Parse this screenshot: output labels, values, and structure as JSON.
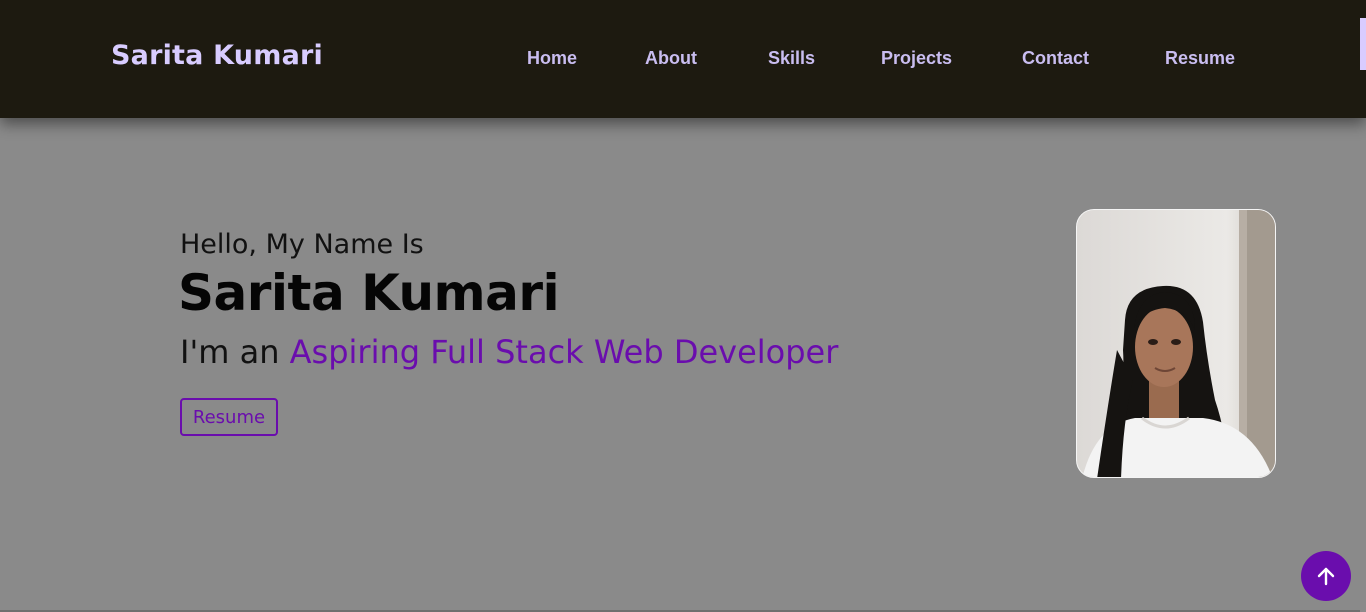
{
  "navbar": {
    "brand": "Sarita Kumari",
    "links": [
      "Home",
      "About",
      "Skills",
      "Projects",
      "Contact",
      "Resume"
    ]
  },
  "hero": {
    "greeting": "Hello, My Name Is",
    "name": "Sarita Kumari",
    "role_prefix": "I'm an ",
    "role_highlight": "Aspiring Full Stack Web Developer",
    "resume_button": "Resume",
    "photo_icon": "profile-photo"
  },
  "scroll_top_icon": "arrow-up-icon",
  "colors": {
    "navbar_bg": "#1d1a10",
    "page_bg": "#8a8a8a",
    "accent": "#6a0dad",
    "nav_text": "#c9bdf0"
  }
}
